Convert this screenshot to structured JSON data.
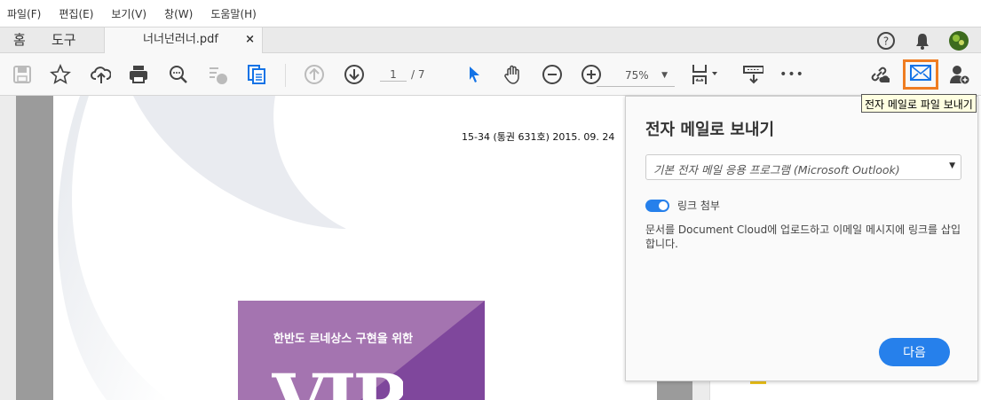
{
  "menu": [
    "파일(F)",
    "편집(E)",
    "보기(V)",
    "창(W)",
    "도움말(H)"
  ],
  "tabs": {
    "home": "홈",
    "tools": "도구",
    "document": "너너넌러너.pdf",
    "close": "×"
  },
  "toolbar": {
    "page_current": "1",
    "page_total": "/ 7",
    "zoom": "75%",
    "more": "•••"
  },
  "tooltip": "전자 메일로 파일 보내기",
  "document": {
    "issue": "15-34 (통권 631호) 2015. 09. 24",
    "cover_subtitle": "한반도 르네상스 구현을 위한",
    "cover_title": "VIP"
  },
  "panel": {
    "title": "전자 메일로 보내기",
    "email_app": "기본 전자 메일 응용 프로그램 (Microsoft Outlook)",
    "toggle_label": "링크 첨부",
    "toggle_on": true,
    "description": "문서를 Document Cloud에 업로드하고 이메일 메시지에 링크를 삽입합니다.",
    "next": "다음"
  },
  "colors": {
    "accent": "#2680eb",
    "highlight": "#ef7d22",
    "cover": "#a474b0"
  }
}
